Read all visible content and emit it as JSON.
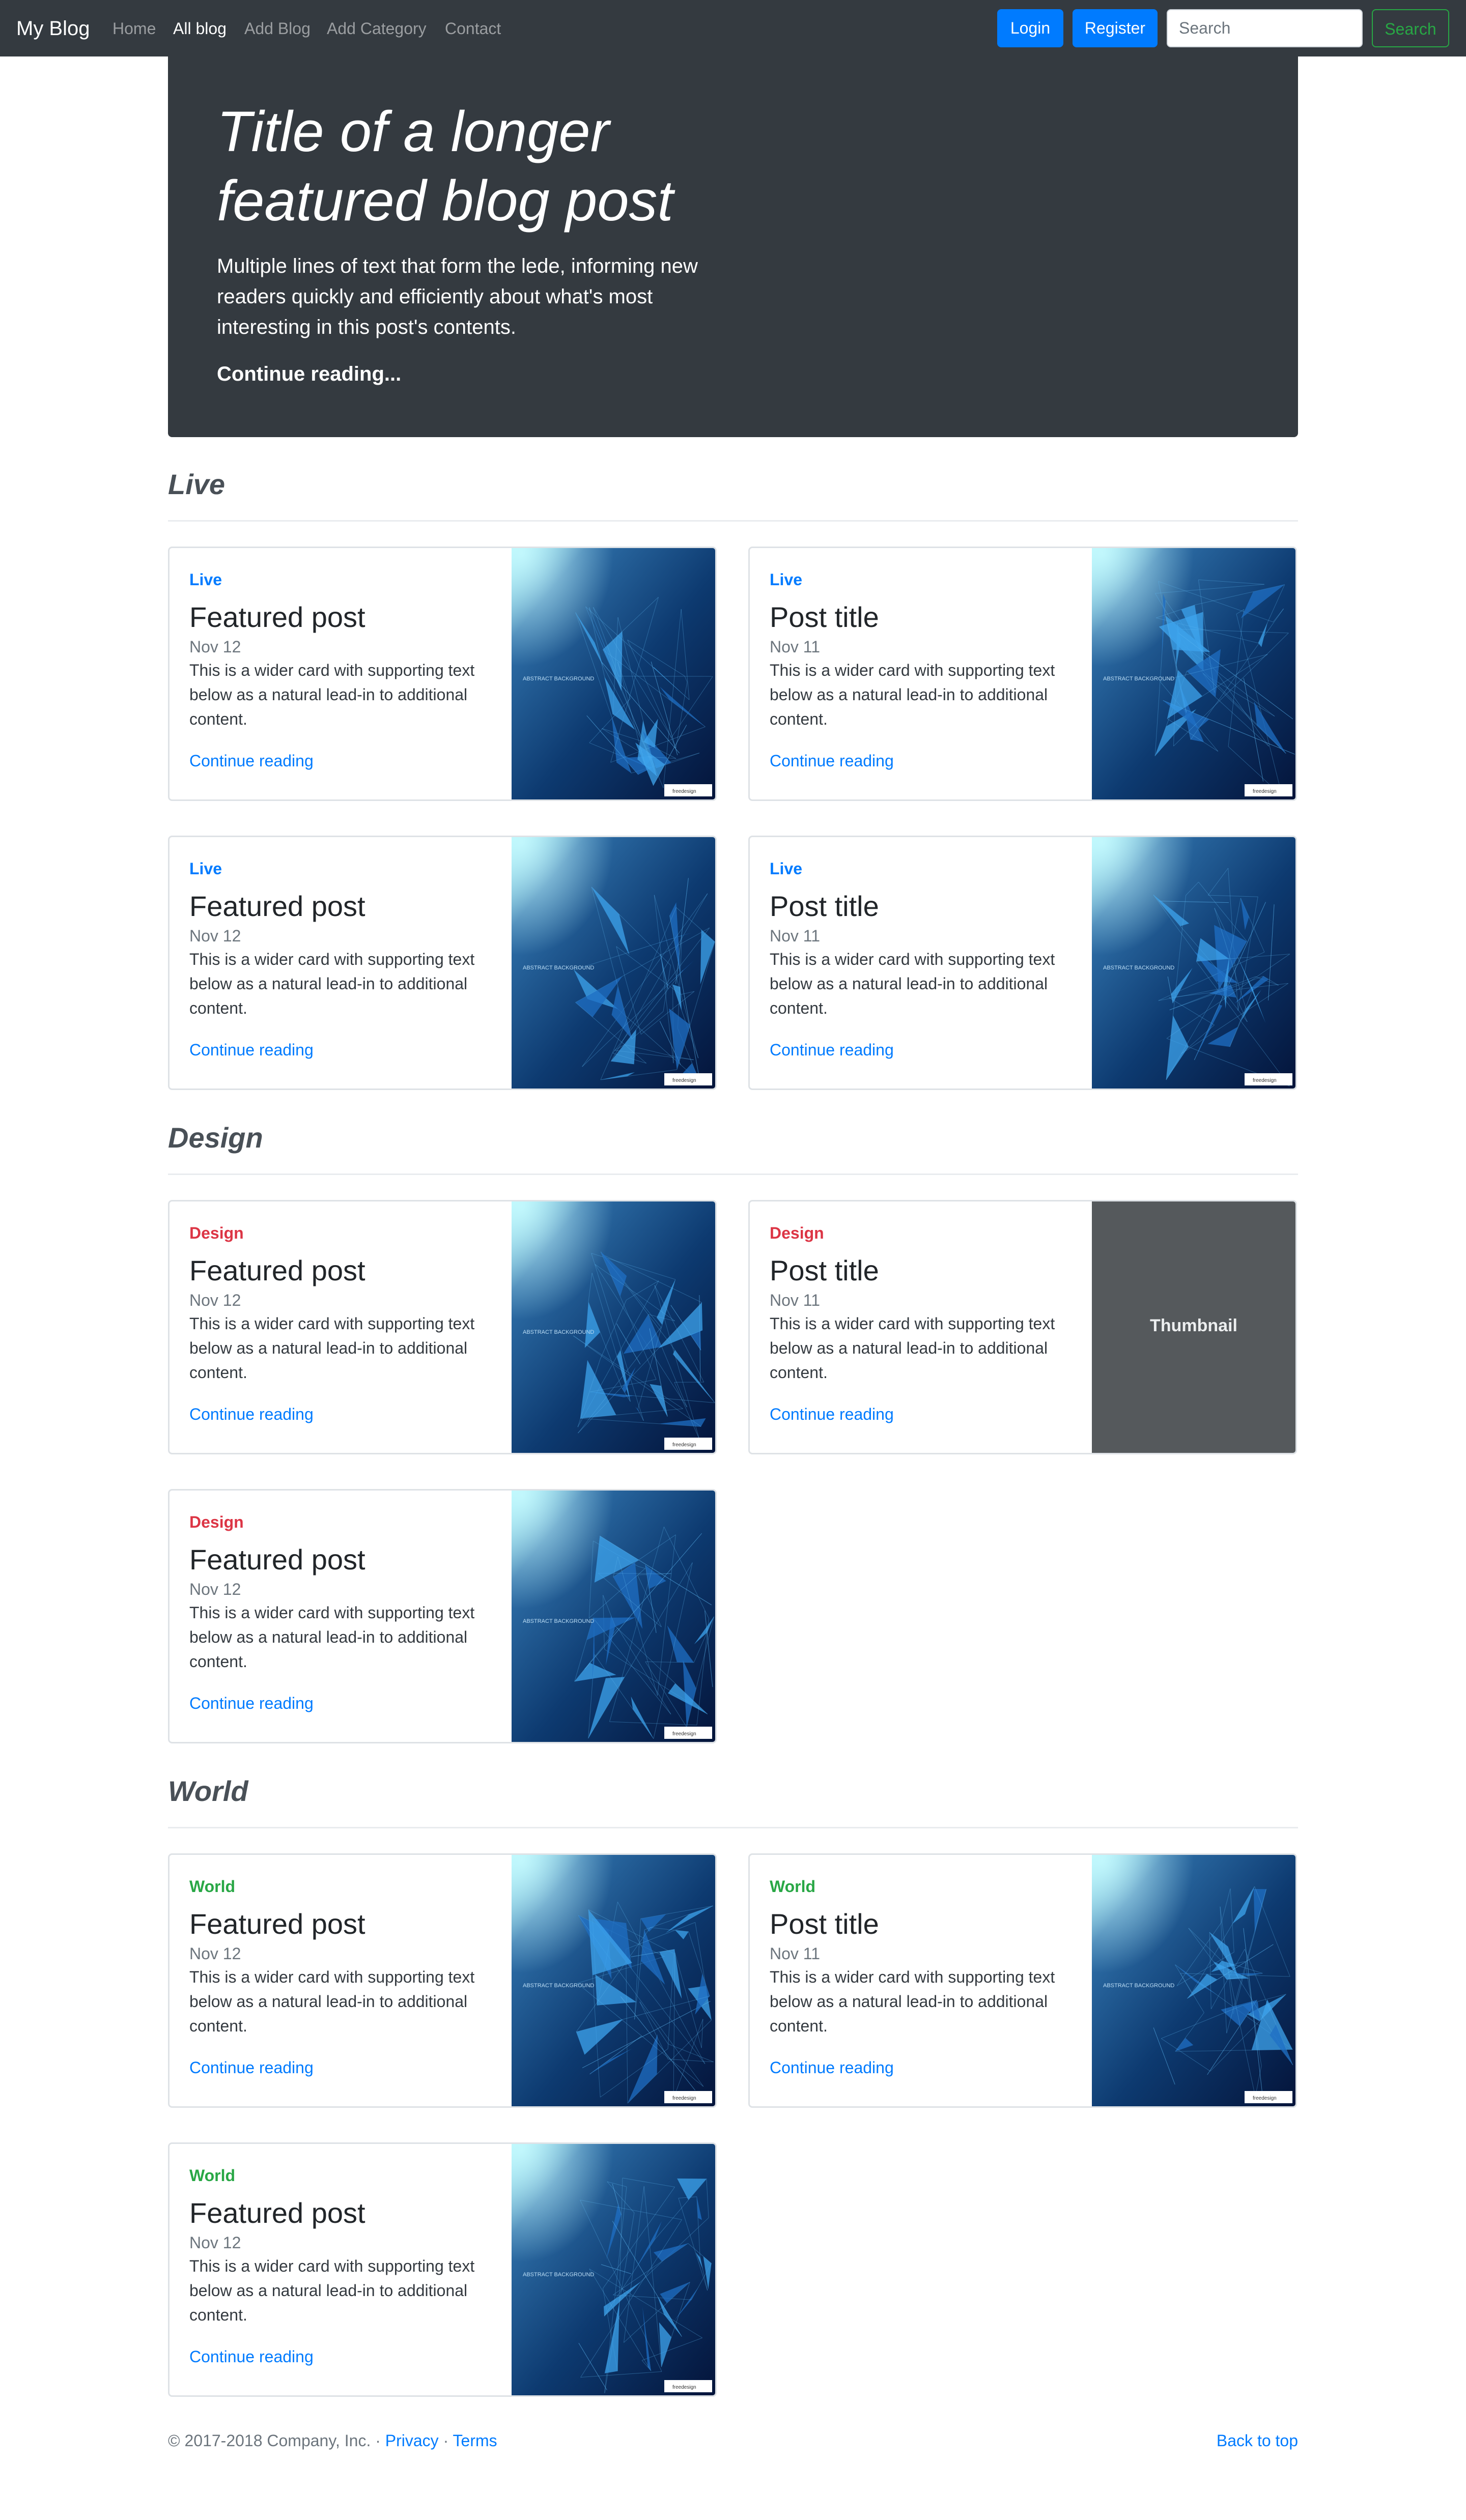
{
  "navbar": {
    "brand": "My Blog",
    "links": [
      {
        "label": "Home",
        "active": false
      },
      {
        "label": "All blog",
        "active": true
      },
      {
        "label": "Add Blog",
        "active": false
      },
      {
        "label": "Add Category",
        "active": false
      },
      {
        "label": "Contact",
        "active": false
      }
    ],
    "login_label": "Login",
    "register_label": "Register",
    "search_placeholder": "Search",
    "search_button_label": "Search"
  },
  "hero": {
    "title": "Title of a longer featured blog post",
    "lede": "Multiple lines of text that form the lede, informing new readers quickly and efficiently about what's most interesting in this post's contents.",
    "link_label": "Continue reading..."
  },
  "colors": {
    "live": "#007bff",
    "design": "#dc3545",
    "world": "#28a745",
    "navbar_bg": "#343a40",
    "primary": "#007bff"
  },
  "thumbnail_image": {
    "heading": "ABSTRACT BACKGROUND",
    "watermark": "freedesign"
  },
  "sections": [
    {
      "title": "Live",
      "cards": [
        {
          "category": "Live",
          "title": "Featured post",
          "date": "Nov 12",
          "text": "This is a wider card with supporting text below as a natural lead-in to additional content.",
          "link": "Continue reading",
          "thumb": "image"
        },
        {
          "category": "Live",
          "title": "Post title",
          "date": "Nov 11",
          "text": "This is a wider card with supporting text below as a natural lead-in to additional content.",
          "link": "Continue reading",
          "thumb": "image"
        },
        {
          "category": "Live",
          "title": "Featured post",
          "date": "Nov 12",
          "text": "This is a wider card with supporting text below as a natural lead-in to additional content.",
          "link": "Continue reading",
          "thumb": "image"
        },
        {
          "category": "Live",
          "title": "Post title",
          "date": "Nov 11",
          "text": "This is a wider card with supporting text below as a natural lead-in to additional content.",
          "link": "Continue reading",
          "thumb": "image"
        }
      ]
    },
    {
      "title": "Design",
      "cards": [
        {
          "category": "Design",
          "title": "Featured post",
          "date": "Nov 12",
          "text": "This is a wider card with supporting text below as a natural lead-in to additional content.",
          "link": "Continue reading",
          "thumb": "image"
        },
        {
          "category": "Design",
          "title": "Post title",
          "date": "Nov 11",
          "text": "This is a wider card with supporting text below as a natural lead-in to additional content.",
          "link": "Continue reading",
          "thumb": "placeholder",
          "thumb_label": "Thumbnail"
        },
        {
          "category": "Design",
          "title": "Featured post",
          "date": "Nov 12",
          "text": "This is a wider card with supporting text below as a natural lead-in to additional content.",
          "link": "Continue reading",
          "thumb": "image"
        }
      ]
    },
    {
      "title": "World",
      "cards": [
        {
          "category": "World",
          "title": "Featured post",
          "date": "Nov 12",
          "text": "This is a wider card with supporting text below as a natural lead-in to additional content.",
          "link": "Continue reading",
          "thumb": "image"
        },
        {
          "category": "World",
          "title": "Post title",
          "date": "Nov 11",
          "text": "This is a wider card with supporting text below as a natural lead-in to additional content.",
          "link": "Continue reading",
          "thumb": "image"
        },
        {
          "category": "World",
          "title": "Featured post",
          "date": "Nov 12",
          "text": "This is a wider card with supporting text below as a natural lead-in to additional content.",
          "link": "Continue reading",
          "thumb": "image"
        }
      ]
    }
  ],
  "footer": {
    "copyright": "© 2017-2018 Company, Inc. ·",
    "privacy_label": "Privacy",
    "separator": "·",
    "terms_label": "Terms",
    "back_to_top_label": "Back to top"
  }
}
